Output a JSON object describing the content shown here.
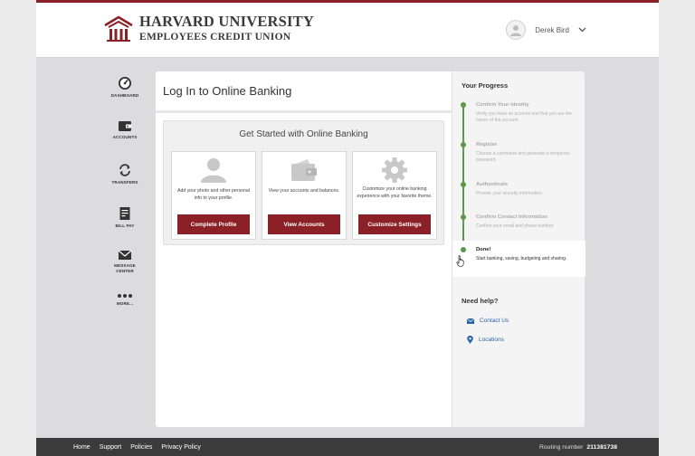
{
  "brand": {
    "line1": "HARVARD UNIVERSITY",
    "line2": "EMPLOYEES CREDIT UNION",
    "accent_color": "#8c2027"
  },
  "user": {
    "name": "Derek Bird",
    "avatar_icon": "user-icon",
    "menu_icon": "chevron-down-icon"
  },
  "sidebar": {
    "items": [
      {
        "label": "DASHBOARD",
        "icon": "dashboard-icon"
      },
      {
        "label": "ACCOUNTS",
        "icon": "wallet-icon"
      },
      {
        "label": "TRANSFERS",
        "icon": "transfer-icon"
      },
      {
        "label": "BILL PAY",
        "icon": "bill-icon"
      },
      {
        "label": "MESSAGE",
        "label2": "CENTER",
        "icon": "envelope-icon"
      },
      {
        "label": "MORE...",
        "icon": "more-icon"
      }
    ]
  },
  "main": {
    "title": "Log In to Online Banking",
    "get_started": {
      "title": "Get Started with Online Banking",
      "cards": [
        {
          "icon": "person-icon",
          "description": "Add your photo and other personal info to your profile.",
          "button": "Complete Profile"
        },
        {
          "icon": "wallet-icon",
          "description": "View your accounts and balances.",
          "button": "View Accounts"
        },
        {
          "icon": "gear-icon",
          "description": "Customize your online banking experience with your favorite theme.",
          "button": "Customize Settings"
        }
      ]
    }
  },
  "progress": {
    "title": "Your Progress",
    "steps": [
      {
        "title": "Confirm Your Identity",
        "description": "Verify you have an account and that you are the owner of the account.",
        "state": "complete"
      },
      {
        "title": "Register",
        "description": "Choose a username and generate a temporary password.",
        "state": "complete"
      },
      {
        "title": "Authenticate",
        "description": "Provide your security information",
        "state": "complete"
      },
      {
        "title": "Confirm Contact Information",
        "description": "Confirm your email and phone number.",
        "state": "complete"
      },
      {
        "title": "Done!",
        "description": "Start banking, saving, budgeting and sharing.",
        "state": "current"
      }
    ],
    "status_color": "#5a9a4a"
  },
  "help": {
    "title": "Need help?",
    "links": [
      {
        "label": "Contact Us",
        "icon": "envelope-icon"
      },
      {
        "label": "Locations",
        "icon": "map-pin-icon"
      }
    ]
  },
  "footer": {
    "links": [
      "Home",
      "Support",
      "Policies",
      "Privacy Policy"
    ],
    "routing_label": "Routing number",
    "routing_number": "211381738"
  }
}
